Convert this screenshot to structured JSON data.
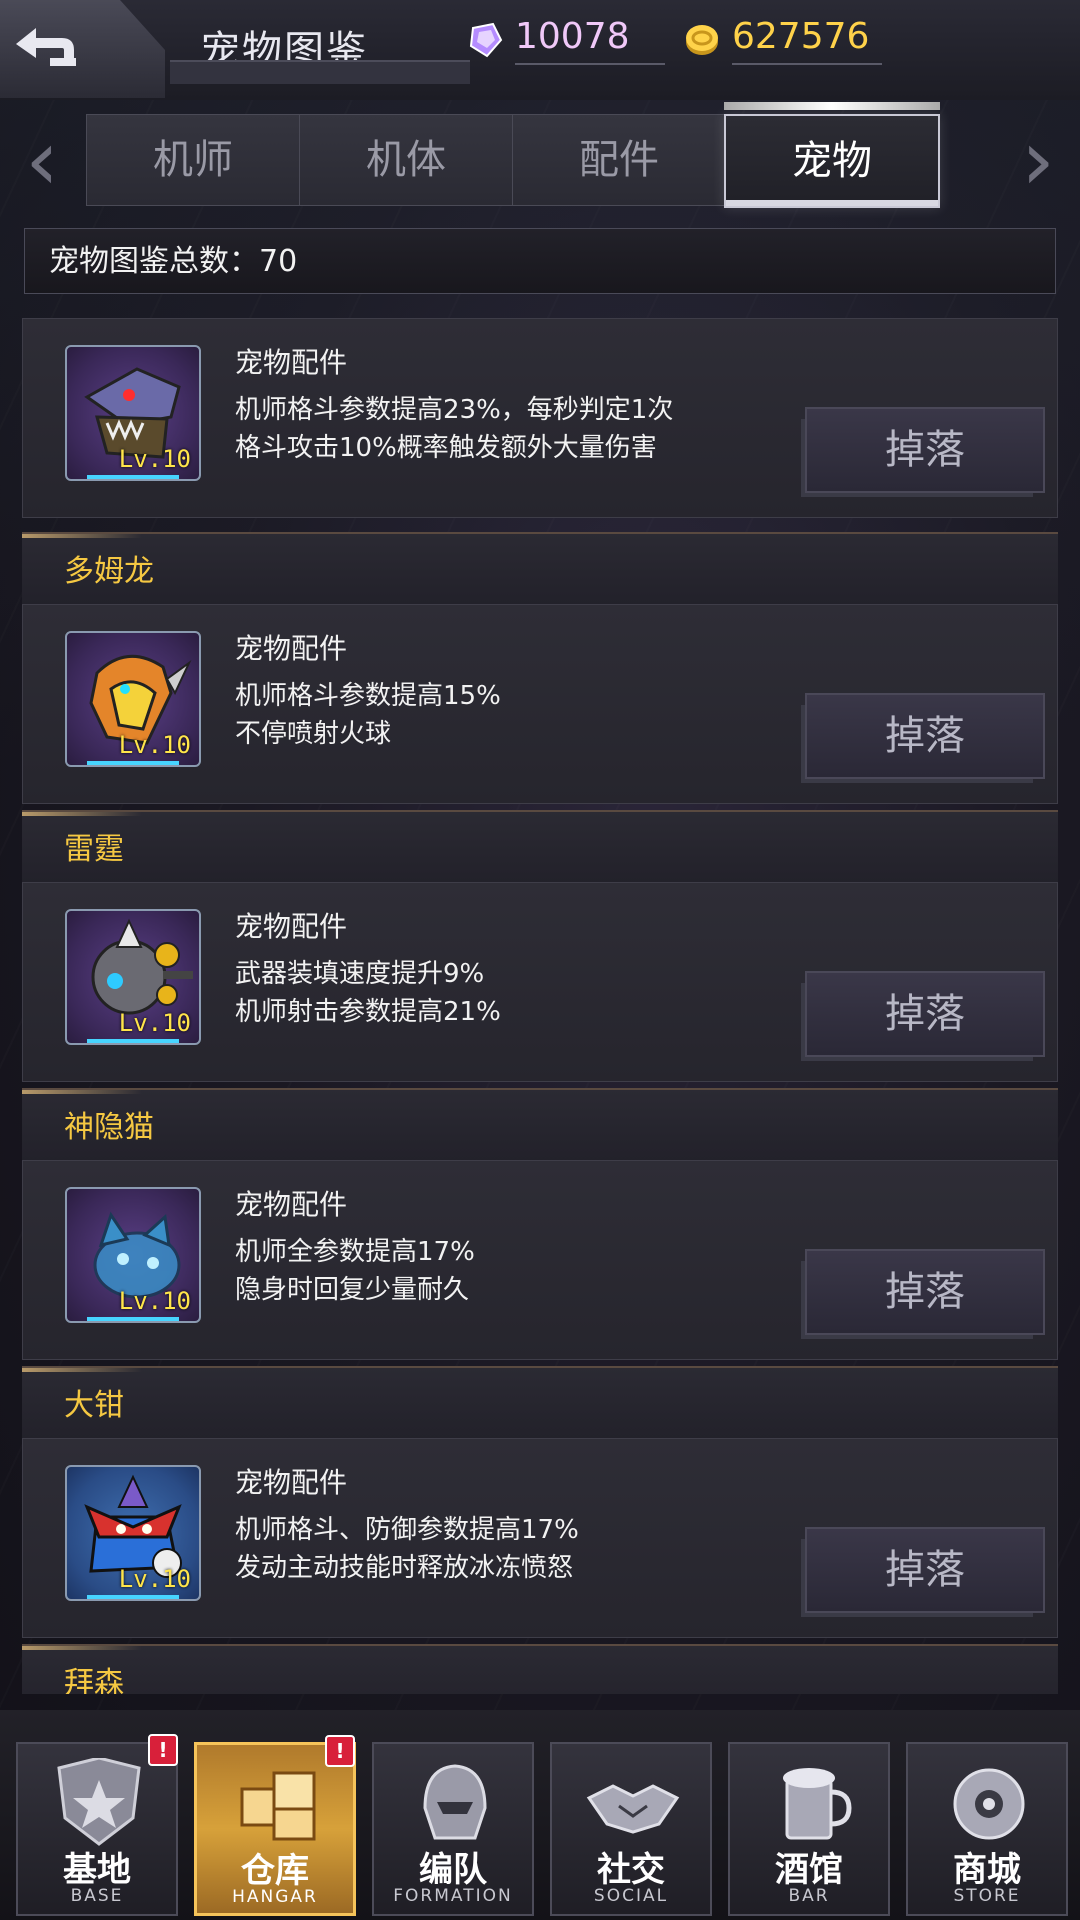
{
  "header": {
    "title": "宠物图鉴",
    "gems": "10078",
    "coins": "627576"
  },
  "tabs": [
    {
      "label": "机师",
      "active": false
    },
    {
      "label": "机体",
      "active": false
    },
    {
      "label": "配件",
      "active": false
    },
    {
      "label": "宠物",
      "active": true
    }
  ],
  "total_label": "宠物图鉴总数：70",
  "pets": [
    {
      "name": "",
      "type": "宠物配件",
      "desc": "机师格斗参数提高23%，每秒判定1次\n格斗攻击10%概率触发额外大量伤害",
      "level": "Lv.10",
      "drop_label": "掉落",
      "icon": "dragon-skull-icon"
    },
    {
      "name": "多姆龙",
      "type": "宠物配件",
      "desc": "机师格斗参数提高15%\n不停喷射火球",
      "level": "Lv.10",
      "drop_label": "掉落",
      "icon": "fire-dragon-icon"
    },
    {
      "name": "雷霆",
      "type": "宠物配件",
      "desc": "武器装填速度提升9%\n机师射击参数提高21%",
      "level": "Lv.10",
      "drop_label": "掉落",
      "icon": "robot-drone-icon"
    },
    {
      "name": "神隐猫",
      "type": "宠物配件",
      "desc": "机师全参数提高17%\n隐身时回复少量耐久",
      "level": "Lv.10",
      "drop_label": "掉落",
      "icon": "stealth-cat-icon"
    },
    {
      "name": "大钳",
      "type": "宠物配件",
      "desc": "机师格斗、防御参数提高17%\n发动主动技能时释放冰冻愤怒",
      "level": "Lv.10",
      "drop_label": "掉落",
      "icon": "claw-robot-icon"
    },
    {
      "name": "拜森"
    }
  ],
  "nav": [
    {
      "label": "基地",
      "sub": "BASE",
      "badge": "!",
      "active": false,
      "icon": "base-emblem-icon"
    },
    {
      "label": "仓库",
      "sub": "HANGAR",
      "badge": "!",
      "active": true,
      "icon": "hangar-crates-icon"
    },
    {
      "label": "编队",
      "sub": "FORMATION",
      "active": false,
      "icon": "formation-helmet-icon"
    },
    {
      "label": "社交",
      "sub": "SOCIAL",
      "active": false,
      "icon": "handshake-icon"
    },
    {
      "label": "酒馆",
      "sub": "BAR",
      "active": false,
      "icon": "bar-mug-icon"
    },
    {
      "label": "商城",
      "sub": "STORE",
      "active": false,
      "icon": "store-orb-icon"
    }
  ]
}
